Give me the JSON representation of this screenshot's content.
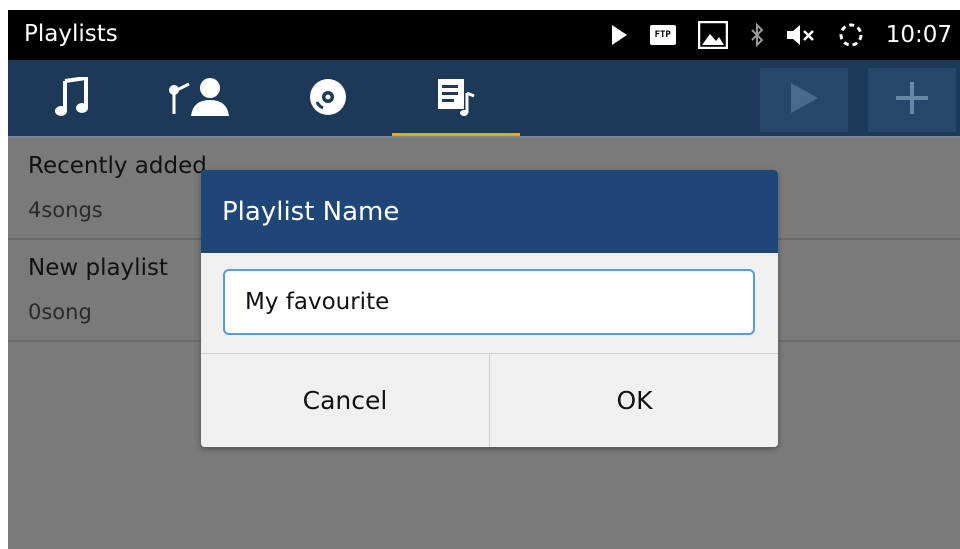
{
  "status_bar": {
    "app_title": "Playlists",
    "time": "10:07",
    "ftp_label": "FTP",
    "icons": [
      "play-icon",
      "ftp-icon",
      "image-icon",
      "bluetooth-icon",
      "volume-muted-icon",
      "sync-icon"
    ]
  },
  "tabs": [
    {
      "name": "songs",
      "icon": "music-note-icon",
      "active": false
    },
    {
      "name": "artists",
      "icon": "artist-icon",
      "active": false
    },
    {
      "name": "albums",
      "icon": "disc-icon",
      "active": false
    },
    {
      "name": "playlists",
      "icon": "playlist-icon",
      "active": true
    }
  ],
  "actions": [
    {
      "icon": "play-icon"
    },
    {
      "icon": "add-icon"
    }
  ],
  "playlists": [
    {
      "title": "Recently added",
      "subtitle": "4songs"
    },
    {
      "title": "New playlist",
      "subtitle": "0song"
    }
  ],
  "dialog": {
    "title": "Playlist Name",
    "input_value": "My favourite",
    "cancel_label": "Cancel",
    "ok_label": "OK"
  },
  "colors": {
    "accent": "#f0a500",
    "tabbar_bg": "#1c3957",
    "dialog_header": "#1e4778",
    "input_border": "#5b9bd5"
  }
}
